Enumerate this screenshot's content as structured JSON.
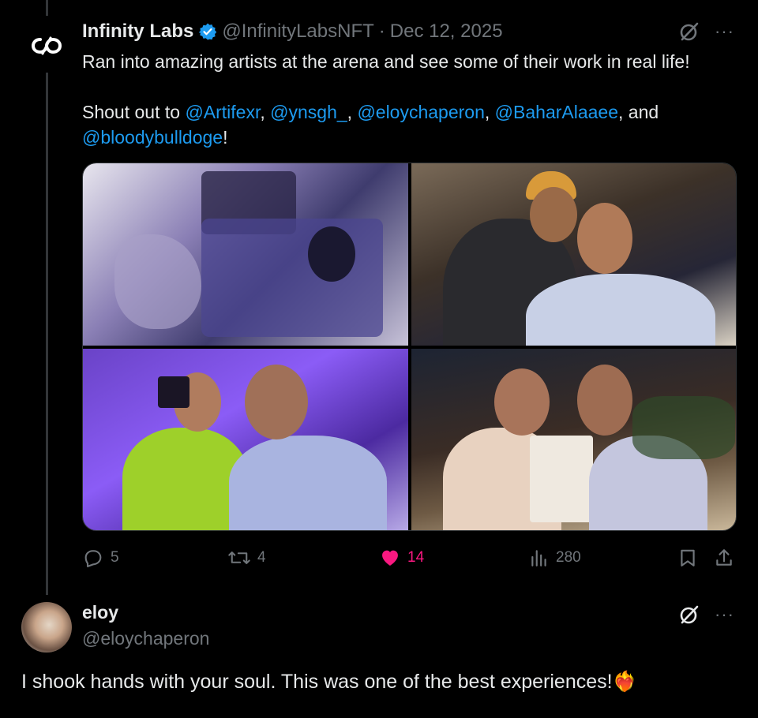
{
  "tweet": {
    "author_name": "Infinity Labs",
    "handle": "@InfinityLabsNFT",
    "separator": "·",
    "date": "Dec 12, 2025",
    "text_line1": "Ran into amazing artists at the arena and see some of their work in real life!",
    "text_shoutout_prefix": "Shout out to ",
    "mentions": [
      "@Artifexr",
      "@ynsgh_",
      "@eloychaperon",
      "@BaharAlaaee",
      "@bloodybulldoge"
    ],
    "comma": ", ",
    "and_text": ", and",
    "exclaim": "!",
    "more_label": "···",
    "media": [
      {
        "name": "artwork-prints-photo"
      },
      {
        "name": "selfie-two-men-photo"
      },
      {
        "name": "selfie-purple-wall-photo"
      },
      {
        "name": "selfie-drawing-photo"
      }
    ],
    "stats": {
      "replies": "5",
      "reposts": "4",
      "likes": "14",
      "views": "280"
    }
  },
  "reply": {
    "author_name": "eloy",
    "handle": "@eloychaperon",
    "text": "I shook hands with your soul. This was one of the best experiences!",
    "emoji": "❤️‍🔥",
    "more_label": "···"
  },
  "colors": {
    "background": "#000000",
    "text": "#e7e9ea",
    "muted": "#71767b",
    "link": "#1d9bf0",
    "like": "#f91880",
    "verified": "#1d9bf0"
  }
}
